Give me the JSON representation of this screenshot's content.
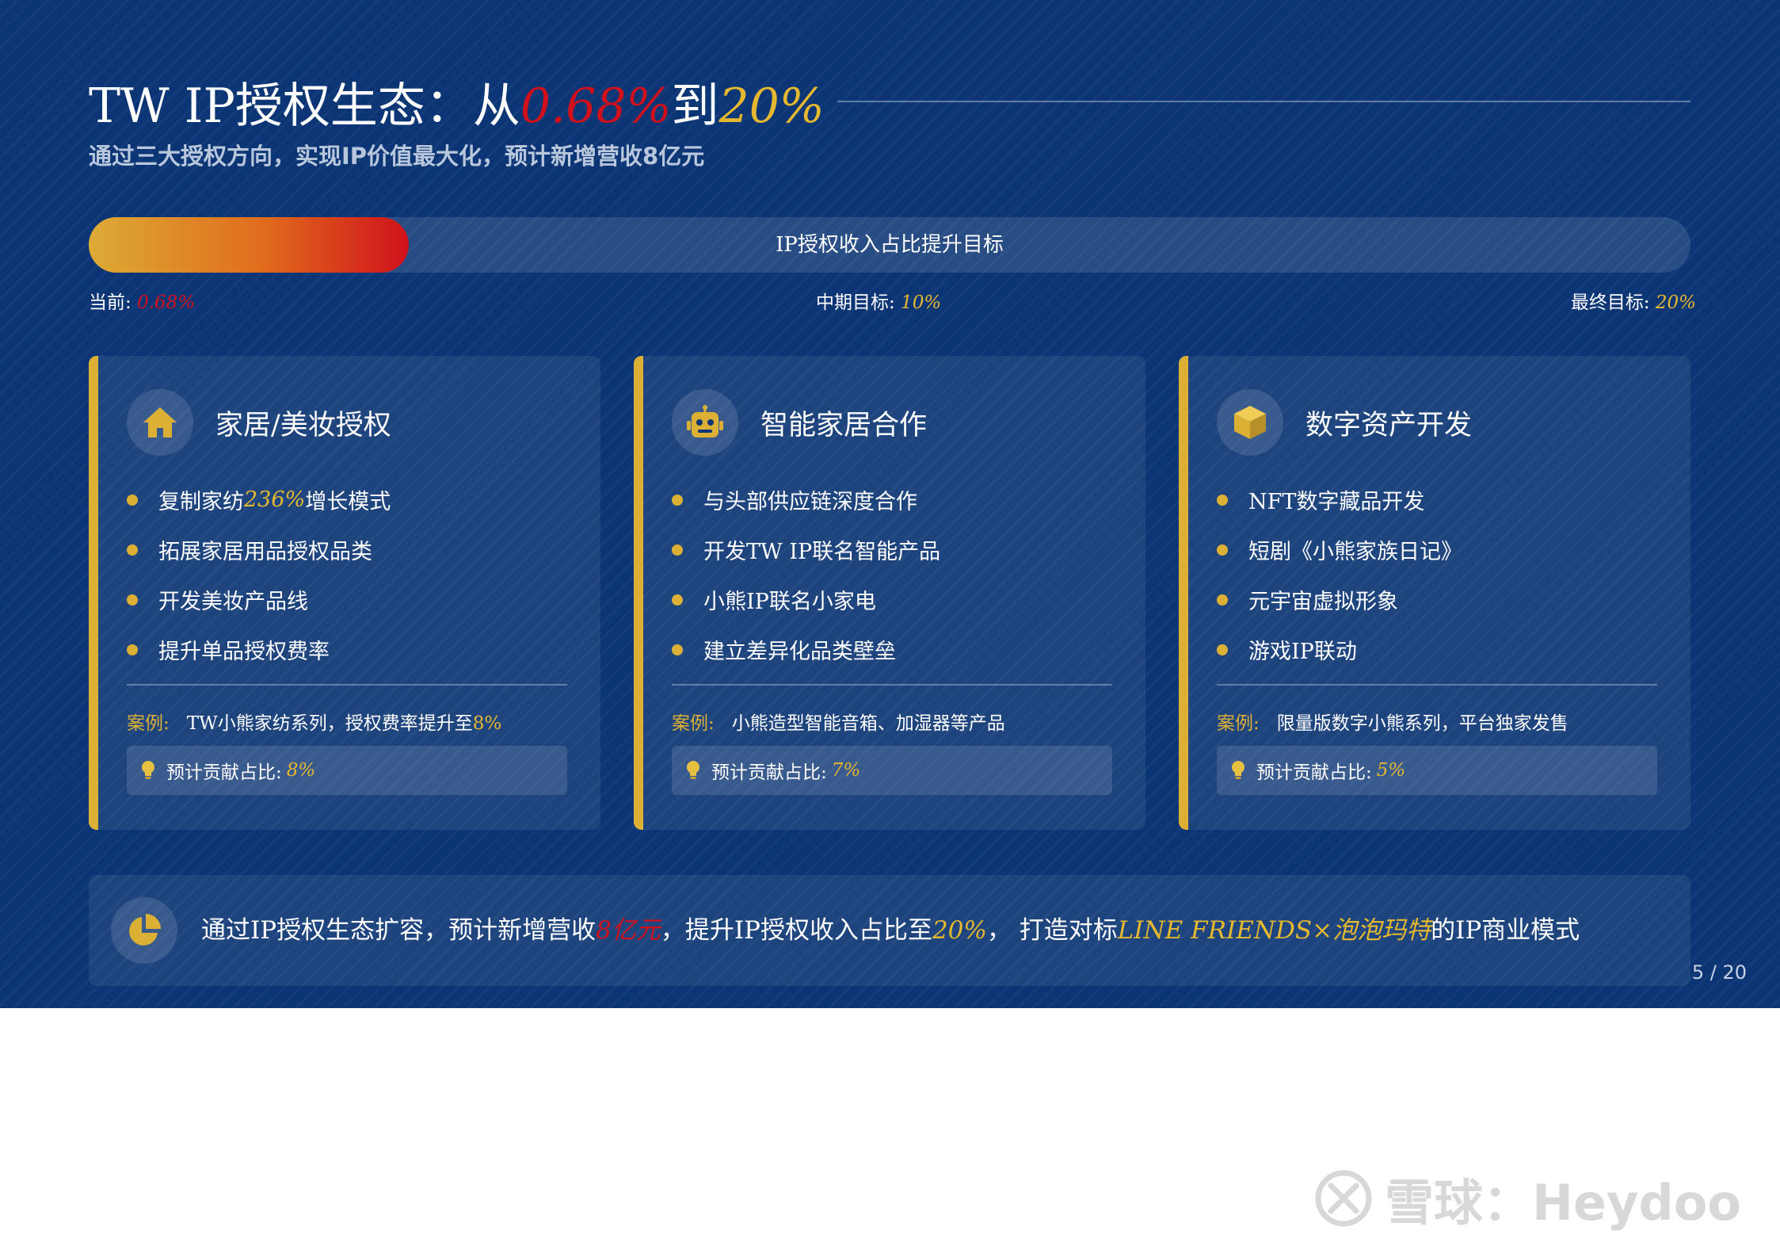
{
  "colors": {
    "background": "#0b3574",
    "gold": "#dcb035",
    "red": "#d0111b",
    "white": "#ffffff"
  },
  "header": {
    "title_prefix": "TW IP授权生态：从",
    "title_from": "0.68%",
    "title_mid": "到",
    "title_to": "20%",
    "subtitle": "通过三大授权方向，实现IP价值最大化，预计新增营收8亿元"
  },
  "progress": {
    "label": "IP授权收入占比提升目标",
    "fill_fraction": 0.2,
    "current_label": "当前: ",
    "current_value": "0.68%",
    "mid_label": "中期目标: ",
    "mid_value": "10%",
    "final_label": "最终目标: ",
    "final_value": "20%"
  },
  "cards": [
    {
      "icon": "home-icon",
      "title": "家居/美妆授权",
      "bullets": [
        {
          "pre": "复制家纺",
          "hl": "236%",
          "post": "增长模式"
        },
        {
          "pre": "拓展家居用品授权品类",
          "hl": "",
          "post": ""
        },
        {
          "pre": "开发美妆产品线",
          "hl": "",
          "post": ""
        },
        {
          "pre": "提升单品授权费率",
          "hl": "",
          "post": ""
        }
      ],
      "case_label": "案例:",
      "case_pre": "TW小熊家纺系列，授权费率提升至",
      "case_hl": "8%",
      "contrib_label": "预计贡献占比:",
      "contrib_value": "8%"
    },
    {
      "icon": "robot-icon",
      "title": "智能家居合作",
      "bullets": [
        {
          "pre": "与头部供应链深度合作",
          "hl": "",
          "post": ""
        },
        {
          "pre": "开发TW IP联名智能产品",
          "hl": "",
          "post": ""
        },
        {
          "pre": "小熊IP联名小家电",
          "hl": "",
          "post": ""
        },
        {
          "pre": "建立差异化品类壁垒",
          "hl": "",
          "post": ""
        }
      ],
      "case_label": "案例:",
      "case_pre": "小熊造型智能音箱、加湿器等产品",
      "case_hl": "",
      "contrib_label": "预计贡献占比:",
      "contrib_value": "7%"
    },
    {
      "icon": "cube-icon",
      "title": "数字资产开发",
      "bullets": [
        {
          "pre": "NFT数字藏品开发",
          "hl": "",
          "post": ""
        },
        {
          "pre": "短剧《小熊家族日记》",
          "hl": "",
          "post": ""
        },
        {
          "pre": "元宇宙虚拟形象",
          "hl": "",
          "post": ""
        },
        {
          "pre": "游戏IP联动",
          "hl": "",
          "post": ""
        }
      ],
      "case_label": "案例:",
      "case_pre": "限量版数字小熊系列，平台独家发售",
      "case_hl": "",
      "contrib_label": "预计贡献占比:",
      "contrib_value": "5%"
    }
  ],
  "summary": {
    "icon": "pie-chart-icon",
    "part1": "通过IP授权生态扩容，预计新增营收",
    "red": "8亿元",
    "part2": "，提升IP授权收入占比至",
    "gold1": "20%",
    "part3": "， 打造对标",
    "gold2": "LINE FRIENDS×泡泡玛特",
    "part4": "的IP商业模式"
  },
  "page_number": "5 / 20",
  "watermark": {
    "icon": "snowball-logo-icon",
    "text": "雪球：Heydoo"
  }
}
